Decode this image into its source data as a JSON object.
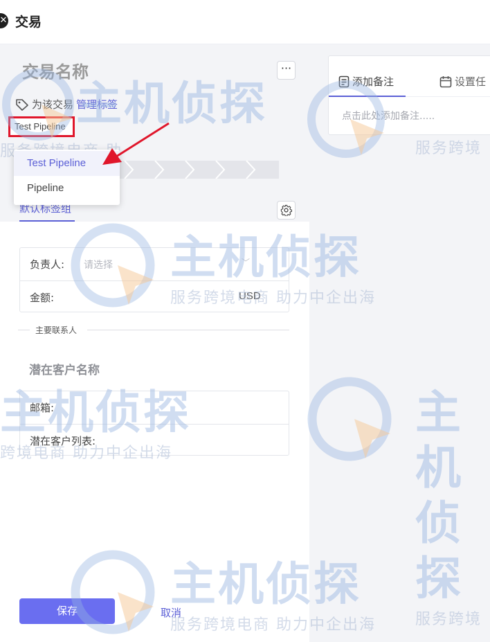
{
  "header": {
    "title": "交易",
    "close_icon": "close-circle-icon"
  },
  "deal": {
    "name_placeholder": "交易名称",
    "tag_prefix": "为该交易",
    "tag_link": "管理标签",
    "pipeline_selected": "Test Pipeline"
  },
  "pipeline_dropdown": {
    "options": [
      "Test Pipeline",
      "Pipeline"
    ],
    "selected_index": 0
  },
  "tabs": {
    "default_group": "默认标签组"
  },
  "form": {
    "owner_label": "负责人:",
    "owner_placeholder": "请选择",
    "amount_label": "金额:",
    "currency": "USD",
    "contact_divider": "主要联系人",
    "prospect_title": "潜在客户名称",
    "email_label": "邮箱:",
    "prospect_list_label": "潜在客户列表:"
  },
  "actions": {
    "save": "保存",
    "cancel": "取消"
  },
  "notes": {
    "tab_note": "添加备注",
    "tab_task": "设置任",
    "placeholder": "点击此处添加备注....."
  },
  "watermark": {
    "brand": "主机侦探",
    "tagline": "服务跨境电商 助力中企出海",
    "tagline_partial_1": "服务跨境电商  助",
    "tagline_partial_2": "跨境电商  助力中企出海",
    "tagline_partial_3": "服务跨境"
  },
  "colors": {
    "accent": "#5b5fd6",
    "save_button": "#6a6ef0",
    "highlight_box": "#e0162b"
  }
}
